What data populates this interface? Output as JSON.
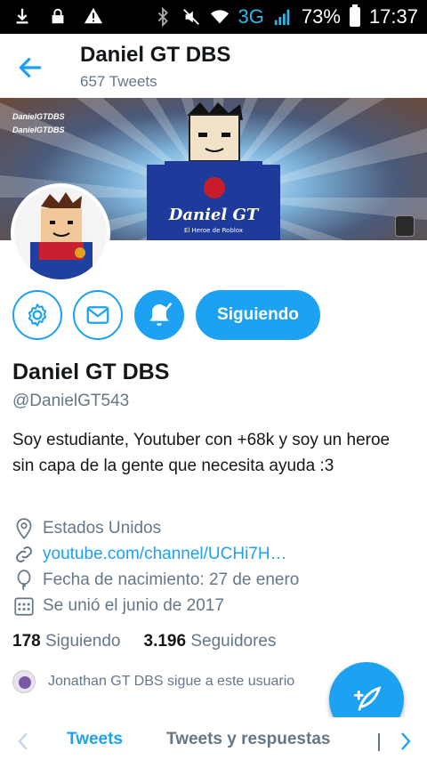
{
  "status_bar": {
    "network": "3G",
    "battery": "73%",
    "time": "17:37",
    "icons": [
      "download-icon",
      "lock-icon",
      "warning-icon",
      "bluetooth-icon",
      "mute-icon",
      "wifi-icon",
      "signal-icon",
      "battery-icon"
    ]
  },
  "header": {
    "title": "Daniel GT DBS",
    "subtitle": "657 Tweets",
    "back_icon": "arrow-left-icon"
  },
  "banner": {
    "tag_line1": "DanielGTDBS",
    "tag_line2": "DanielGTDBS",
    "logo_text": "Daniel GT",
    "logo_sub": "El Heroe de Roblox"
  },
  "actions": {
    "settings_icon": "gear-icon",
    "message_icon": "envelope-icon",
    "notify_icon": "bell-check-icon",
    "follow_label": "Siguiendo"
  },
  "profile": {
    "name": "Daniel GT DBS",
    "handle": "@DanielGT543",
    "bio": "Soy estudiante, Youtuber con +68k y soy un heroe sin capa de la gente que necesita ayuda :3",
    "location": "Estados Unidos",
    "website": "youtube.com/channel/UCHi7H…",
    "birthday": "Fecha de nacimiento: 27 de enero",
    "joined": "Se unió el junio de 2017"
  },
  "stats": {
    "following_count": "178",
    "following_label": "Siguiendo",
    "followers_count": "3.196",
    "followers_label": "Seguidores"
  },
  "followed_by": {
    "text": "Jonathan GT DBS sigue a este usuario"
  },
  "tabs": {
    "items": [
      "Tweets",
      "Tweets y respuestas"
    ],
    "active": "Tweets"
  },
  "colors": {
    "accent": "#1da1f2",
    "text_primary": "#14171a",
    "text_secondary": "#657786"
  }
}
